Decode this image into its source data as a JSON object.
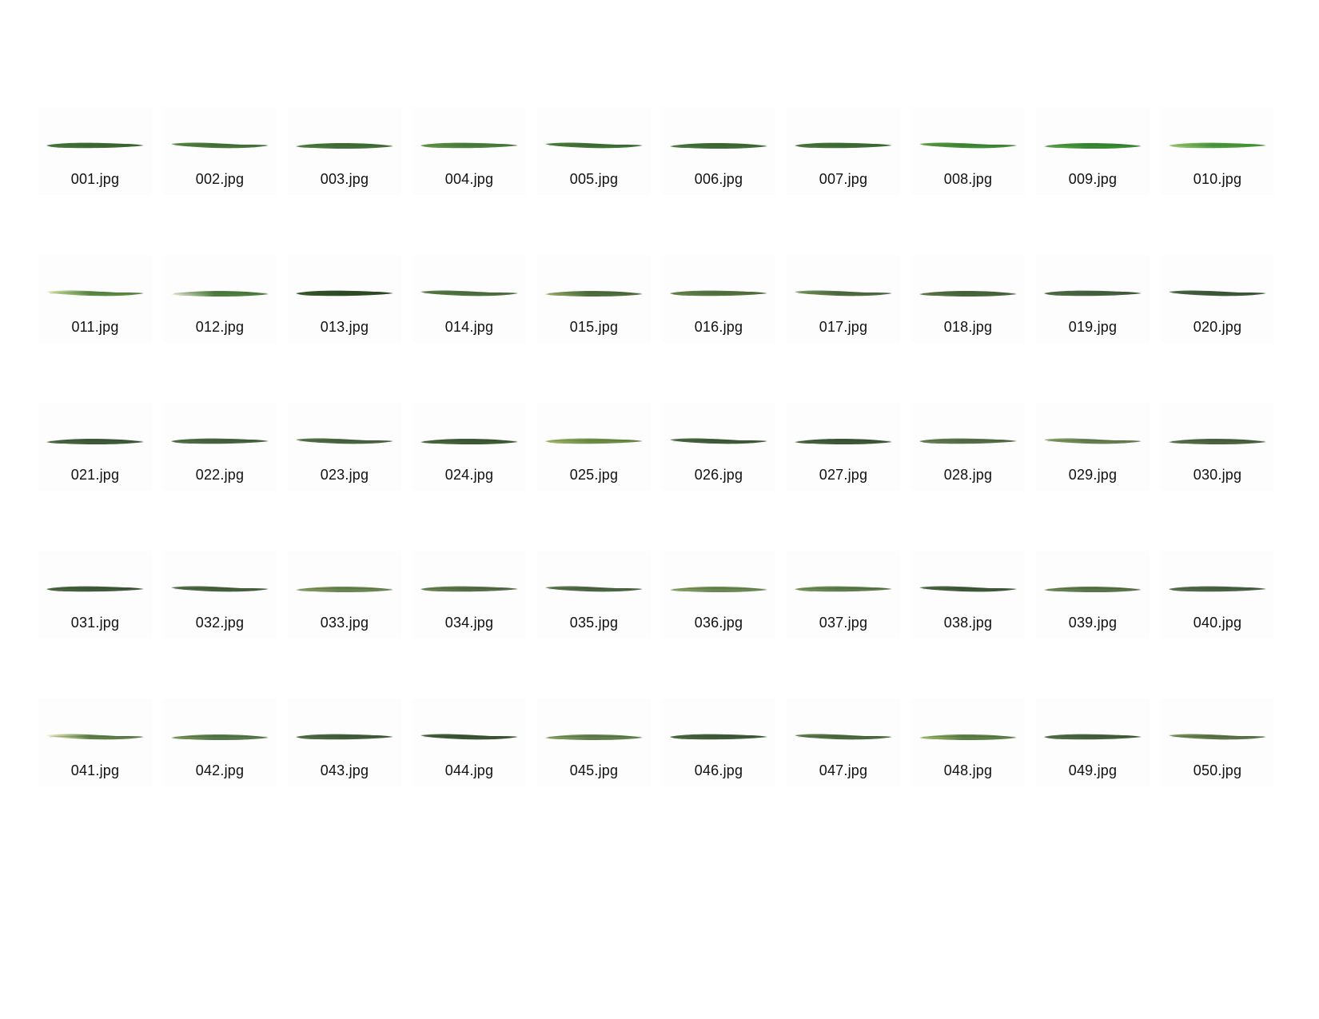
{
  "gallery": {
    "items": [
      {
        "label": "001.jpg",
        "colors": [
          "#4a7a3c",
          "#3d6a33"
        ]
      },
      {
        "label": "002.jpg",
        "colors": [
          "#5c8a44",
          "#46733a"
        ]
      },
      {
        "label": "003.jpg",
        "colors": [
          "#4f7e3f",
          "#416f37"
        ]
      },
      {
        "label": "004.jpg",
        "colors": [
          "#6a9a4e",
          "#4c7e3e"
        ]
      },
      {
        "label": "005.jpg",
        "colors": [
          "#4e8040",
          "#3f7036"
        ]
      },
      {
        "label": "006.jpg",
        "colors": [
          "#4a7a3e",
          "#3d6a35"
        ]
      },
      {
        "label": "007.jpg",
        "colors": [
          "#4d7a3e",
          "#406c37"
        ]
      },
      {
        "label": "008.jpg",
        "colors": [
          "#5fa046",
          "#3f8a36"
        ]
      },
      {
        "label": "009.jpg",
        "colors": [
          "#5ea448",
          "#3a8a34"
        ]
      },
      {
        "label": "010.jpg",
        "colors": [
          "#a8cf7a",
          "#4a9a3c"
        ]
      },
      {
        "label": "011.jpg",
        "colors": [
          "#e2ecb0",
          "#5a8a44"
        ]
      },
      {
        "label": "012.jpg",
        "colors": [
          "#e6ecd4",
          "#4e7e3e"
        ]
      },
      {
        "label": "013.jpg",
        "colors": [
          "#3a5a2c",
          "#2e4c26"
        ]
      },
      {
        "label": "014.jpg",
        "colors": [
          "#5a7e48",
          "#4e7040"
        ]
      },
      {
        "label": "015.jpg",
        "colors": [
          "#9ab06a",
          "#4e6e3e"
        ]
      },
      {
        "label": "016.jpg",
        "colors": [
          "#6a8a52",
          "#55723f"
        ]
      },
      {
        "label": "017.jpg",
        "colors": [
          "#7e9a5c",
          "#4e6c40"
        ]
      },
      {
        "label": "018.jpg",
        "colors": [
          "#5e7a4a",
          "#48663c"
        ]
      },
      {
        "label": "019.jpg",
        "colors": [
          "#54704a",
          "#44603e"
        ]
      },
      {
        "label": "020.jpg",
        "colors": [
          "#4c6844",
          "#3c5838"
        ]
      },
      {
        "label": "021.jpg",
        "colors": [
          "#4e6a42",
          "#3e5a38"
        ]
      },
      {
        "label": "022.jpg",
        "colors": [
          "#56744a",
          "#46623e"
        ]
      },
      {
        "label": "023.jpg",
        "colors": [
          "#5a764c",
          "#486440"
        ]
      },
      {
        "label": "024.jpg",
        "colors": [
          "#4c6a3e",
          "#3e5a34"
        ]
      },
      {
        "label": "025.jpg",
        "colors": [
          "#a8bc6e",
          "#6e8e48"
        ]
      },
      {
        "label": "026.jpg",
        "colors": [
          "#4e6a42",
          "#3e5a38"
        ]
      },
      {
        "label": "027.jpg",
        "colors": [
          "#4a6640",
          "#3c5636"
        ]
      },
      {
        "label": "028.jpg",
        "colors": [
          "#6a8456",
          "#566e48"
        ]
      },
      {
        "label": "029.jpg",
        "colors": [
          "#8aa468",
          "#667e50"
        ]
      },
      {
        "label": "030.jpg",
        "colors": [
          "#5a744c",
          "#4a6240"
        ]
      },
      {
        "label": "031.jpg",
        "colors": [
          "#4e6a44",
          "#405a3a"
        ]
      },
      {
        "label": "032.jpg",
        "colors": [
          "#56724a",
          "#46603e"
        ]
      },
      {
        "label": "033.jpg",
        "colors": [
          "#8aa064",
          "#6a8452"
        ]
      },
      {
        "label": "034.jpg",
        "colors": [
          "#6e8a56",
          "#566e48"
        ]
      },
      {
        "label": "035.jpg",
        "colors": [
          "#5e7a50",
          "#4c6644"
        ]
      },
      {
        "label": "036.jpg",
        "colors": [
          "#8aa466",
          "#6c8852"
        ]
      },
      {
        "label": "037.jpg",
        "colors": [
          "#7a9a5c",
          "#5e7c4c"
        ]
      },
      {
        "label": "038.jpg",
        "colors": [
          "#4e6a46",
          "#40583a"
        ]
      },
      {
        "label": "039.jpg",
        "colors": [
          "#6e8a56",
          "#5a7448"
        ]
      },
      {
        "label": "040.jpg",
        "colors": [
          "#5a7450",
          "#4a6244"
        ]
      },
      {
        "label": "041.jpg",
        "colors": [
          "#eef0c0",
          "#5e8048"
        ]
      },
      {
        "label": "042.jpg",
        "colors": [
          "#7a9a5a",
          "#56784a"
        ]
      },
      {
        "label": "043.jpg",
        "colors": [
          "#56724a",
          "#445e3c"
        ]
      },
      {
        "label": "044.jpg",
        "colors": [
          "#46623c",
          "#3a5434"
        ]
      },
      {
        "label": "045.jpg",
        "colors": [
          "#86a262",
          "#62804e"
        ]
      },
      {
        "label": "046.jpg",
        "colors": [
          "#4e6c44",
          "#405a3a"
        ]
      },
      {
        "label": "047.jpg",
        "colors": [
          "#62804e",
          "#4c6a40"
        ]
      },
      {
        "label": "048.jpg",
        "colors": [
          "#a4be6c",
          "#5e8048"
        ]
      },
      {
        "label": "049.jpg",
        "colors": [
          "#56724a",
          "#46603e"
        ]
      },
      {
        "label": "050.jpg",
        "colors": [
          "#7a9458",
          "#5a7448"
        ]
      }
    ]
  }
}
